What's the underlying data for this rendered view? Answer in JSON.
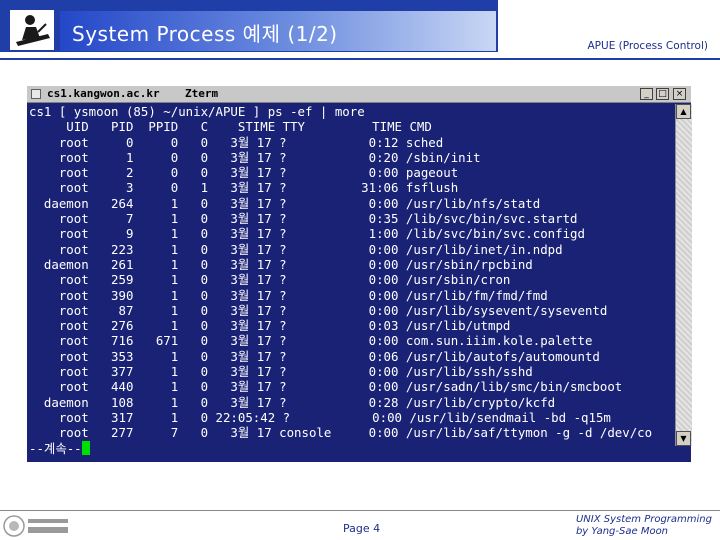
{
  "slide": {
    "title": "System Process 예제 (1/2)",
    "subtitle": "APUE (Process Control)",
    "page_label": "Page 4",
    "credit_line1": "UNIX System Programming",
    "credit_line2": "by Yang-Sae Moon"
  },
  "xterm": {
    "host": "cs1.kangwon.ac.kr",
    "app": "Zterm",
    "window_buttons": [
      "_",
      "□",
      "×"
    ],
    "terminal_text": "cs1 [ ysmoon (85) ~/unix/APUE ] ps -ef | more\n     UID   PID  PPID   C    STIME TTY         TIME CMD\n    root     0     0   0   3월 17 ?           0:12 sched\n    root     1     0   0   3월 17 ?           0:20 /sbin/init\n    root     2     0   0   3월 17 ?           0:00 pageout\n    root     3     0   1   3월 17 ?          31:06 fsflush\n  daemon   264     1   0   3월 17 ?           0:00 /usr/lib/nfs/statd\n    root     7     1   0   3월 17 ?           0:35 /lib/svc/bin/svc.startd\n    root     9     1   0   3월 17 ?           1:00 /lib/svc/bin/svc.configd\n    root   223     1   0   3월 17 ?           0:00 /usr/lib/inet/in.ndpd\n  daemon   261     1   0   3월 17 ?           0:00 /usr/sbin/rpcbind\n    root   259     1   0   3월 17 ?           0:00 /usr/sbin/cron\n    root   390     1   0   3월 17 ?           0:00 /usr/lib/fm/fmd/fmd\n    root    87     1   0   3월 17 ?           0:00 /usr/lib/sysevent/syseventd\n    root   276     1   0   3월 17 ?           0:03 /usr/lib/utmpd\n    root   716   671   0   3월 17 ?           0:00 com.sun.iiim.kole.palette\n    root   353     1   0   3월 17 ?           0:06 /usr/lib/autofs/automountd\n    root   377     1   0   3월 17 ?           0:00 /usr/lib/ssh/sshd\n    root   440     1   0   3월 17 ?           0:00 /usr/sadn/lib/smc/bin/smcboot\n  daemon   108     1   0   3월 17 ?           0:28 /usr/lib/crypto/kcfd\n    root   317     1   0 22:05:42 ?           0:00 /usr/lib/sendmail -bd -q15m\n    root   277     7   0   3월 17 console     0:00 /usr/lib/saf/ttymon -g -d /dev/co",
    "more_prompt": "--계속--"
  },
  "colors": {
    "header_blue": "#1f3ea8",
    "terminal_bg": "#1a2275",
    "terminal_fg": "#ffffff",
    "cursor": "#00e000",
    "footer_text": "#1d2f8c"
  },
  "icons": {
    "header_logo": "person-at-desk-icon",
    "footer_logo": "university-seal-icon"
  }
}
